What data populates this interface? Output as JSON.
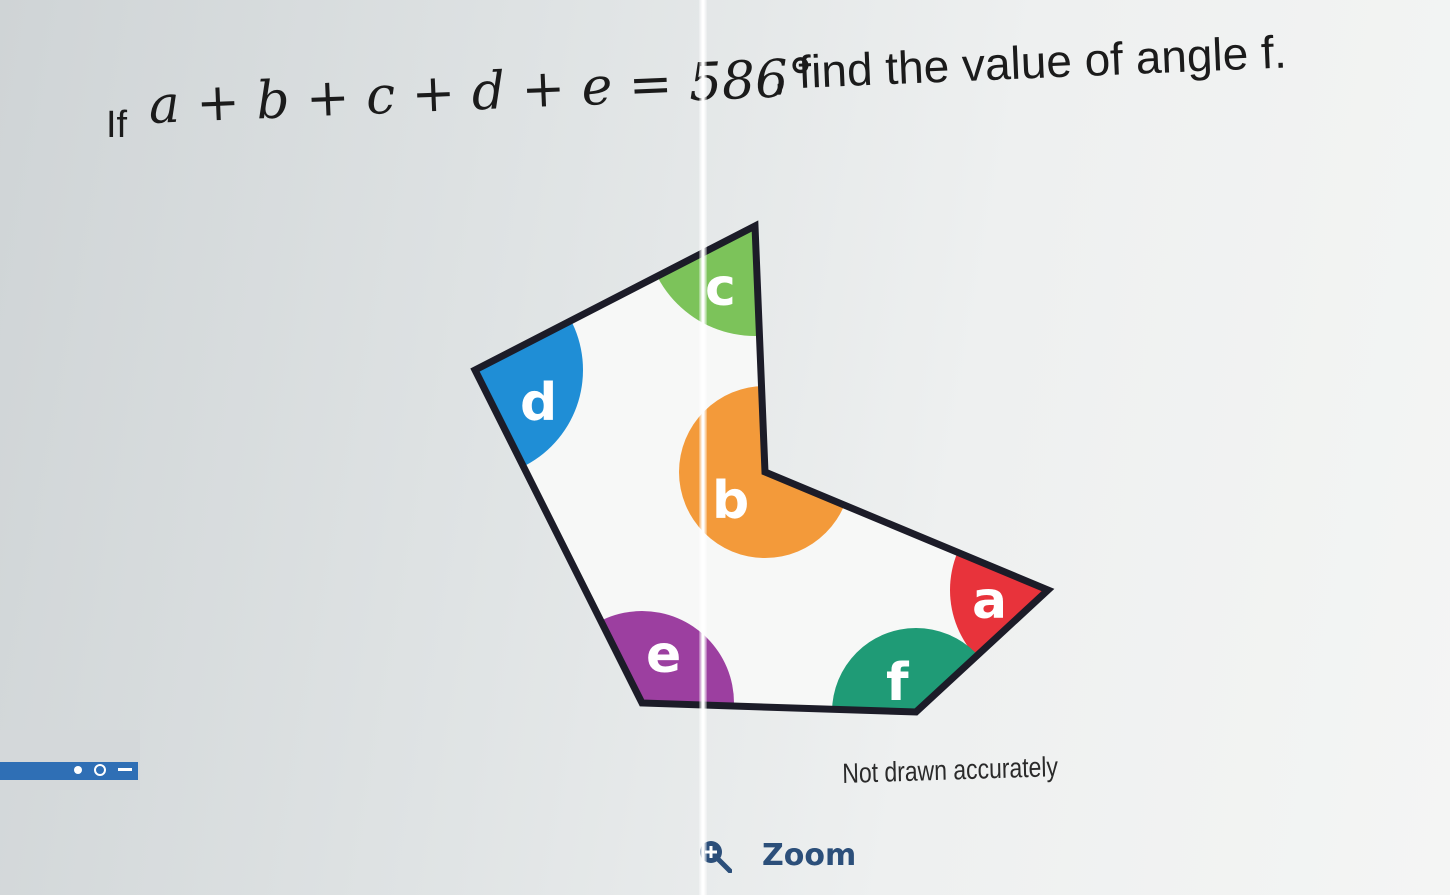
{
  "question": {
    "prefix": "If",
    "equation": "a + b + c + d + e = 586°",
    "suffix": ", find the value of angle f."
  },
  "diagram": {
    "angles": [
      {
        "label": "c",
        "color": "#7cc35a"
      },
      {
        "label": "d",
        "color": "#1f8ed6"
      },
      {
        "label": "b",
        "color": "#f39a3a"
      },
      {
        "label": "a",
        "color": "#e8333b"
      },
      {
        "label": "f",
        "color": "#1f9b76"
      },
      {
        "label": "e",
        "color": "#9c3fa0"
      }
    ],
    "outline_color": "#1c1c28"
  },
  "caption": "Not drawn accurately",
  "zoom": {
    "label": "Zoom",
    "icon": "zoom-in-icon",
    "color": "#2c4f7a"
  }
}
